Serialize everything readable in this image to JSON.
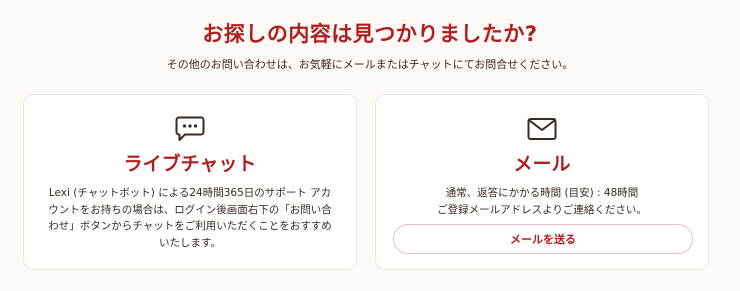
{
  "header": {
    "title": "お探しの内容は見つかりましたか?",
    "subtitle": "その他のお問い合わせは、お気軽にメールまたはチャットにてお問合せください。"
  },
  "cards": {
    "chat": {
      "icon": "chat-bubble-icon",
      "title": "ライブチャット",
      "lines": [
        "Lexi (チャットボット) による24時間365日のサポート アカ",
        "ウントをお持ちの場合は、ログイン後画面右下の「お問い合",
        "わせ」ボタンからチャットをご利用いただくことをおすすめ",
        "いたします。"
      ]
    },
    "mail": {
      "icon": "envelope-icon",
      "title": "メール",
      "lines": [
        "通常、返答にかかる時間 (目安) : 48時間",
        "ご登録メールアドレスよりご連絡ください。"
      ],
      "button_label": "メールを送る"
    }
  },
  "colors": {
    "accent": "#b01e1e",
    "background": "#fdf9f6",
    "card_background": "#ffffff",
    "text": "#3a2a22",
    "button_border": "#ecbfbf"
  }
}
